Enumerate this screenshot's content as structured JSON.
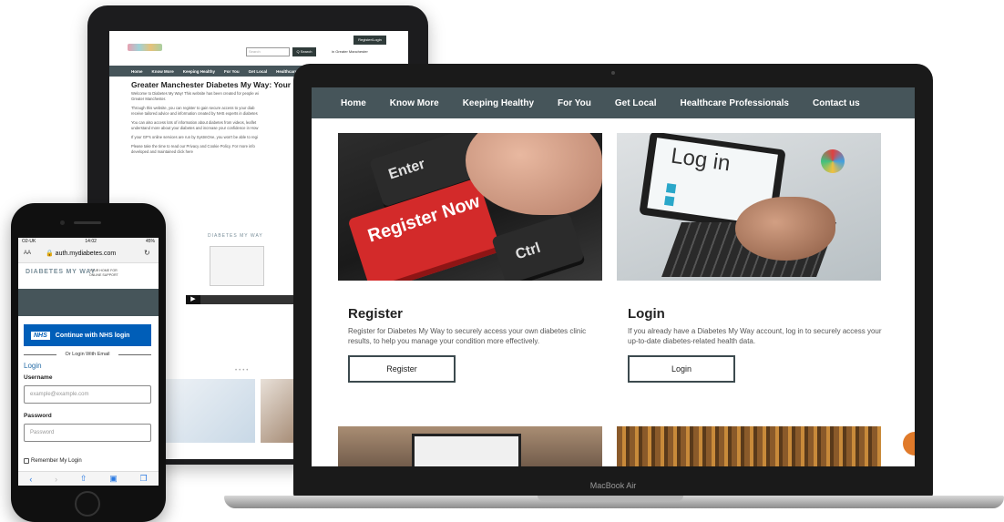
{
  "tablet": {
    "search_placeholder": "Search",
    "search_button": "Q Search",
    "register_login": "Register/Login",
    "region": "in Greater Manchester",
    "nav": [
      "Home",
      "Know More",
      "Keeping Healthy",
      "For You",
      "Get Local",
      "Healthcare"
    ],
    "title": "Greater Manchester Diabetes My Way: Your home",
    "paragraphs": [
      "Welcome to Diabetes My Way! This website has been created for people wi",
      "Greater Manchester.",
      "Through this website, you can register to gain secure access to your diab",
      "receive tailored advice and information created by NHS experts in diabetes",
      "You can also access lots of information about diabetes from videos, leaflet",
      "understand more about your diabetes and increase your confidence in How",
      "If your GP's online services are run by SystmOne, you won't be able to regi",
      "Please take the time to read our Privacy and Cookie Policy. For more info",
      "developed and maintained click here"
    ],
    "video_logo": "DIABETES MY WAY"
  },
  "laptop": {
    "brand": "MacBook Air",
    "nav": [
      "Home",
      "Know More",
      "Keeping Healthy",
      "For You",
      "Get Local",
      "Healthcare Professionals",
      "Contact us"
    ],
    "image1": {
      "key_enter": "Enter",
      "key_red": "Register Now",
      "key_ctrl": "Ctrl"
    },
    "image2": {
      "login_word": "Log in"
    },
    "register": {
      "title": "Register",
      "text": "Register for Diabetes My Way to securely access your own diabetes clinic results, to help you manage your condition more effectively.",
      "button": "Register"
    },
    "login": {
      "title": "Login",
      "text": "If you already have a Diabetes My Way account, log in to securely access your up-to-date diabetes-related health data.",
      "button": "Login"
    }
  },
  "phone": {
    "status": {
      "carrier": "O2-UK",
      "time": "14:02",
      "battery": "45%"
    },
    "url": "auth.mydiabetes.com",
    "aa": "AA",
    "logo": "DIABETES MY WAY",
    "tagline": "YOUR HOME FOR ONLINE SUPPORT",
    "nhs_logo": "NHS",
    "nhs_button": "Continue with NHS login",
    "or_text": "Or Login With Email",
    "login_link": "Login",
    "username_label": "Username",
    "username_placeholder": "example@example.com",
    "password_label": "Password",
    "password_placeholder": "Password",
    "remember": "Remember My Login"
  },
  "colors": {
    "nav_bg": "#46555a",
    "nhs_blue": "#005eb8",
    "register_red": "#d32a2a"
  }
}
